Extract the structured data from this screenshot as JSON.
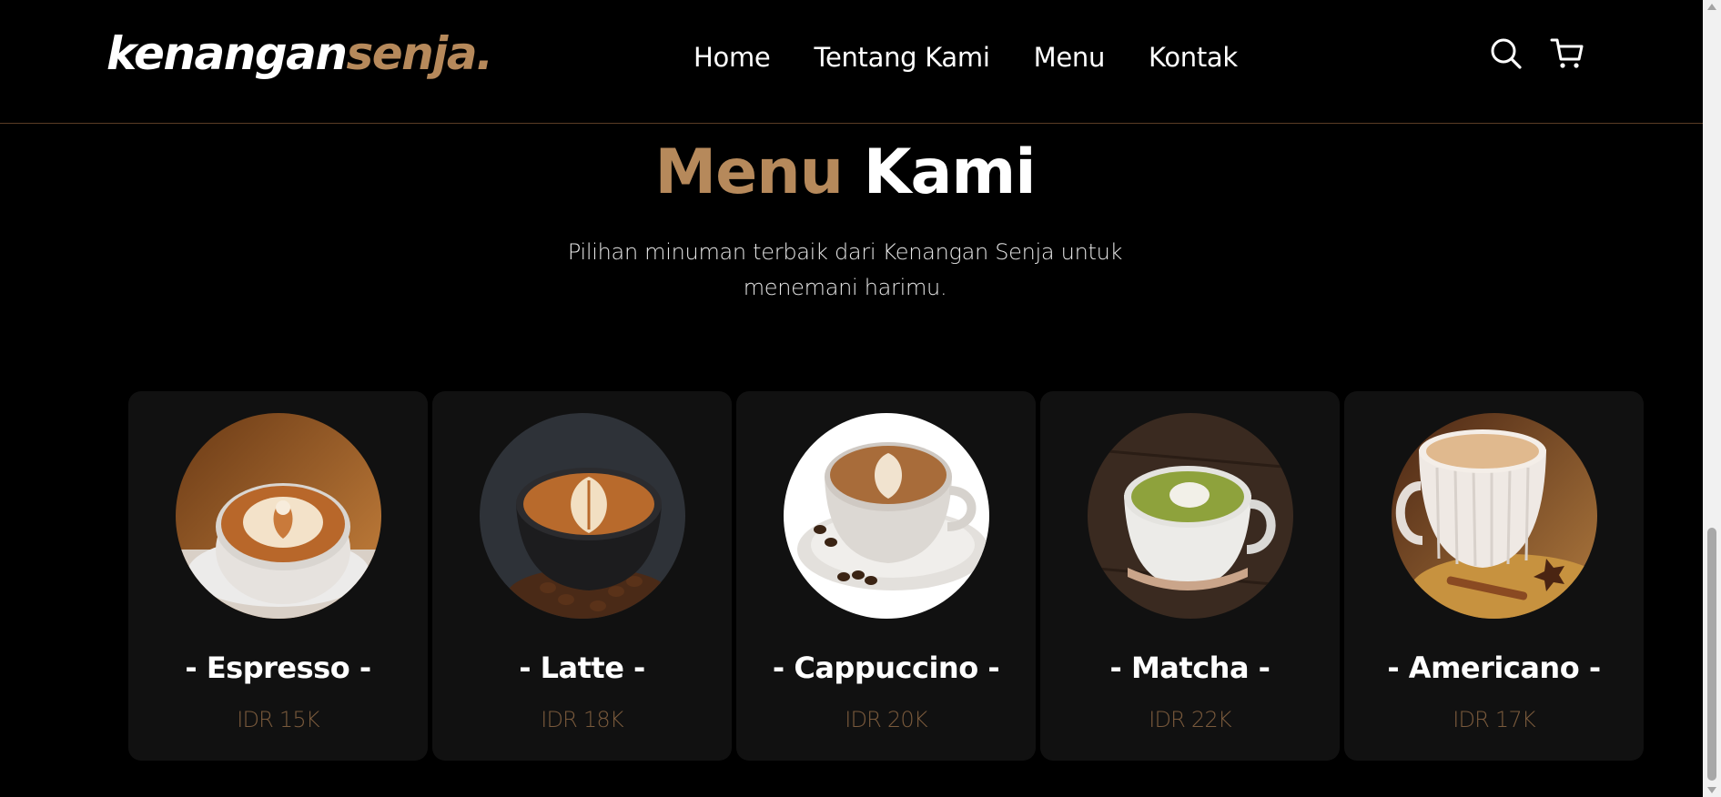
{
  "navbar": {
    "brand_main": "kenangan",
    "brand_accent": "senja.",
    "links": [
      "Home",
      "Tentang Kami",
      "Menu",
      "Kontak"
    ],
    "icons": [
      "search-icon",
      "shopping-cart-icon"
    ]
  },
  "section": {
    "title_accent": "Menu",
    "title_rest": "Kami",
    "description": "Pilihan minuman terbaik dari Kenangan Senja untuk menemani harimu."
  },
  "menu_items": [
    {
      "name": "- Espresso -",
      "price": "IDR 15K"
    },
    {
      "name": "- Latte -",
      "price": "IDR 18K"
    },
    {
      "name": "- Cappuccino -",
      "price": "IDR 20K"
    },
    {
      "name": "- Matcha -",
      "price": "IDR 22K"
    },
    {
      "name": "- Americano -",
      "price": "IDR 17K"
    }
  ],
  "colors": {
    "accent": "#b6895b",
    "background": "#000000",
    "card": "#111111",
    "price": "#7a5a3c"
  }
}
